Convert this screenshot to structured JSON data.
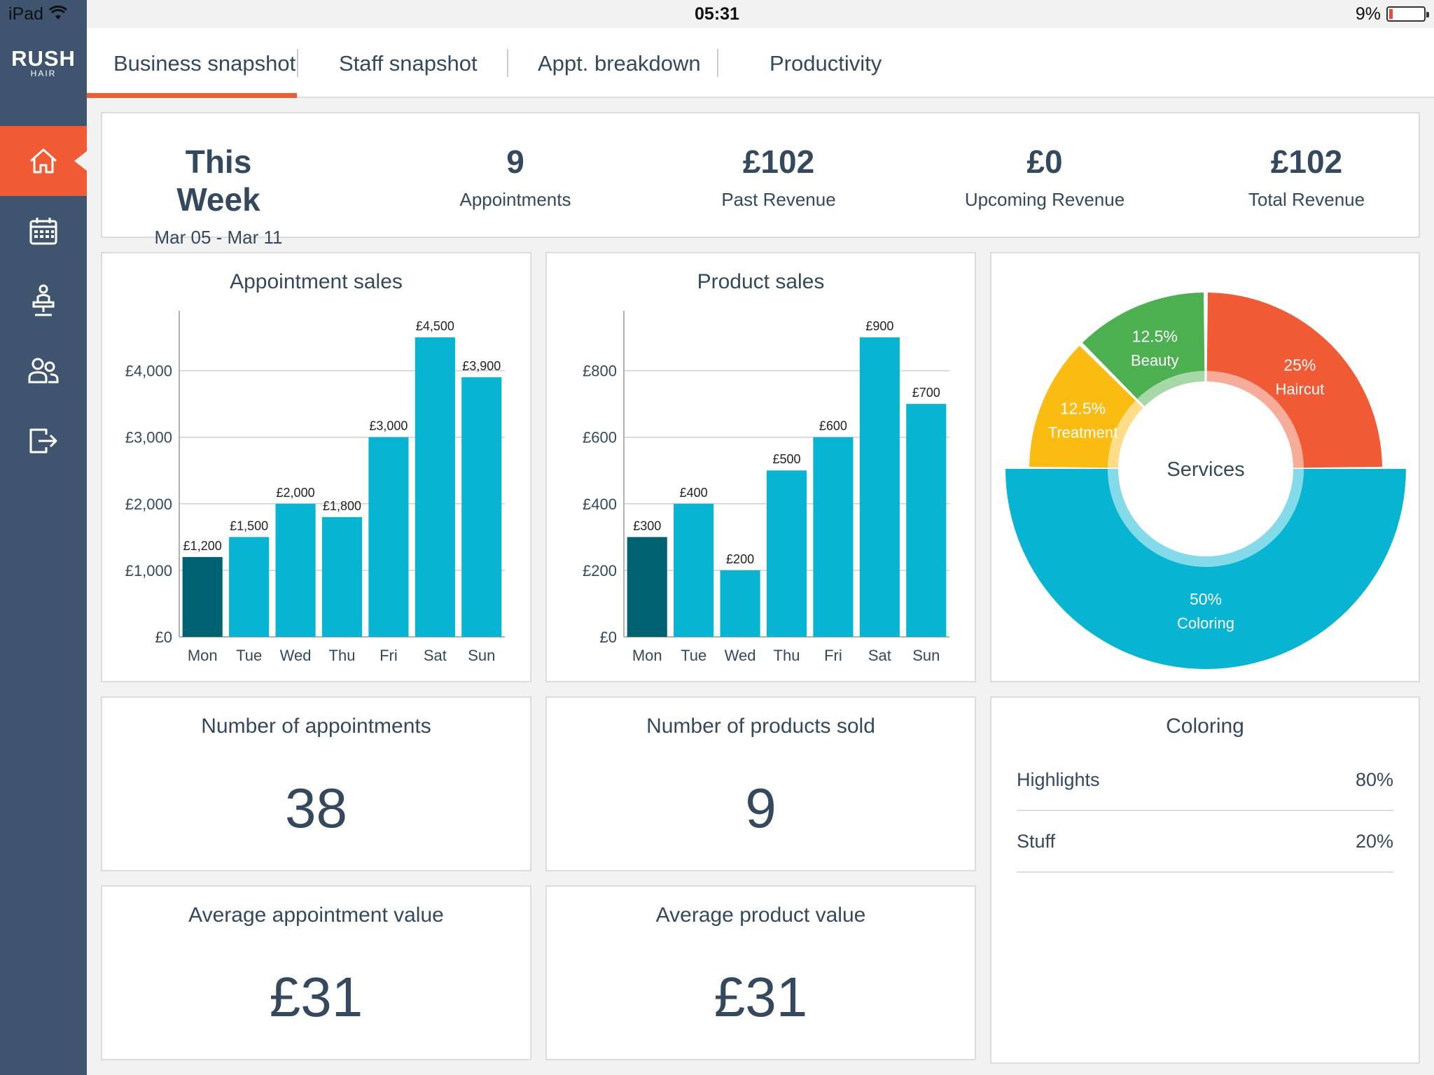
{
  "status": {
    "carrier": "iPad",
    "time": "05:31",
    "battery": "9%"
  },
  "brand": {
    "name": "RUSH",
    "sub": "HAIR"
  },
  "tabs": [
    {
      "label": "Business snapshot",
      "active": true
    },
    {
      "label": "Staff snapshot",
      "active": false
    },
    {
      "label": "Appt. breakdown",
      "active": false
    },
    {
      "label": "Productivity",
      "active": false
    }
  ],
  "nav": [
    {
      "icon": "home-icon",
      "active": true
    },
    {
      "icon": "calendar-icon",
      "active": false
    },
    {
      "icon": "salon-chair-icon",
      "active": false
    },
    {
      "icon": "clients-icon",
      "active": false
    },
    {
      "icon": "logout-icon",
      "active": false
    }
  ],
  "summary": {
    "period": "This Week",
    "range": "Mar 05 - Mar 11",
    "appointments_value": "9",
    "appointments_label": "Appointments",
    "past_value": "£102",
    "past_label": "Past Revenue",
    "upcoming_value": "£0",
    "upcoming_label": "Upcoming Revenue",
    "total_value": "£102",
    "total_label": "Total Revenue"
  },
  "colors": {
    "accent": "#f05a35",
    "sidebar": "#3f546e",
    "bar": "#07b5d3",
    "bar_highlight": "#006270",
    "coloring": "#07b5d3",
    "haircut": "#f05a35",
    "beauty": "#4caf50",
    "treatment": "#fbbc12"
  },
  "chart_data": [
    {
      "type": "bar",
      "title": "Appointment sales",
      "categories": [
        "Mon",
        "Tue",
        "Wed",
        "Thu",
        "Fri",
        "Sat",
        "Sun"
      ],
      "values": [
        1200,
        1500,
        2000,
        1800,
        3000,
        4500,
        3900
      ],
      "value_labels": [
        "£1,200",
        "£1,500",
        "£2,000",
        "£1,800",
        "£3,000",
        "£4,500",
        "£3,900"
      ],
      "yticks": [
        0,
        1000,
        2000,
        3000,
        4000
      ],
      "ytick_labels": [
        "£0",
        "£1,000",
        "£2,000",
        "£3,000",
        "£4,000"
      ],
      "ylim": [
        0,
        4900
      ],
      "highlight_index": 0,
      "grid": true
    },
    {
      "type": "bar",
      "title": "Product sales",
      "categories": [
        "Mon",
        "Tue",
        "Wed",
        "Thu",
        "Fri",
        "Sat",
        "Sun"
      ],
      "values": [
        300,
        400,
        200,
        500,
        600,
        900,
        700
      ],
      "value_labels": [
        "£300",
        "£400",
        "£200",
        "£500",
        "£600",
        "£900",
        "£700"
      ],
      "yticks": [
        0,
        200,
        400,
        600,
        800
      ],
      "ytick_labels": [
        "£0",
        "£200",
        "£400",
        "£600",
        "£800"
      ],
      "ylim": [
        0,
        980
      ],
      "highlight_index": 0,
      "grid": true
    },
    {
      "type": "pie",
      "title": "Services",
      "slices": [
        {
          "name": "Coloring",
          "value": 50,
          "label": "50%"
        },
        {
          "name": "Haircut",
          "value": 25,
          "label": "25%"
        },
        {
          "name": "Beauty",
          "value": 12.5,
          "label": "12.5%"
        },
        {
          "name": "Treatment",
          "value": 12.5,
          "label": "12.5%"
        }
      ]
    }
  ],
  "appointments_count": {
    "title": "Number of appointments",
    "value": "38"
  },
  "products_count": {
    "title": "Number of products sold",
    "value": "9"
  },
  "avg_appointment": {
    "title": "Average appointment value",
    "value": "£31"
  },
  "avg_product": {
    "title": "Average product value",
    "value": "£31"
  },
  "coloring": {
    "title": "Coloring",
    "rows": [
      {
        "label": "Highlights",
        "value": "80%"
      },
      {
        "label": "Stuff",
        "value": "20%"
      }
    ]
  }
}
